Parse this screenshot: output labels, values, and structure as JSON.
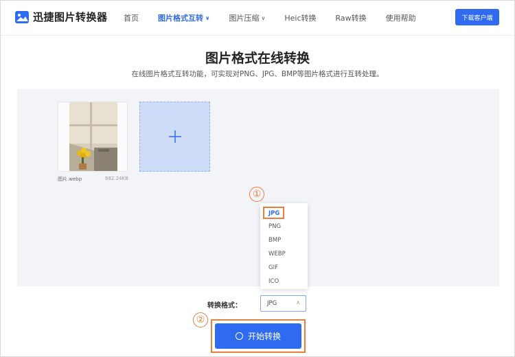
{
  "app": {
    "logo_text": "迅捷图片转换器",
    "icon": "image-logo-icon"
  },
  "nav": {
    "items": [
      {
        "label": "首页"
      },
      {
        "label": "图片格式互转",
        "active": true,
        "has_dropdown": true
      },
      {
        "label": "图片压缩",
        "has_dropdown": true
      },
      {
        "label": "Heic转换"
      },
      {
        "label": "Raw转换"
      },
      {
        "label": "使用帮助"
      }
    ],
    "download_label": "下载客户端"
  },
  "main": {
    "title": "图片格式在线转换",
    "subtitle": "在线图片格式互转功能，可实现对PNG、JPG、BMP等图片格式进行互转处理。"
  },
  "upload": {
    "file_name": "图片.webp",
    "file_size": "682.24KB",
    "add_icon": "plus-icon"
  },
  "format_dropdown": {
    "options": [
      "JPG",
      "PNG",
      "BMP",
      "WEBP",
      "GIF",
      "ICO"
    ],
    "selected": "JPG"
  },
  "format_row": {
    "label": "转换格式：",
    "value": "JPG"
  },
  "start_button": {
    "label": "开始转换"
  },
  "annotations": {
    "step1": "①",
    "step2": "②"
  },
  "colors": {
    "primary": "#2f6bf0",
    "annotation": "#f07c3a",
    "panel_bg": "#f2f4f8"
  }
}
